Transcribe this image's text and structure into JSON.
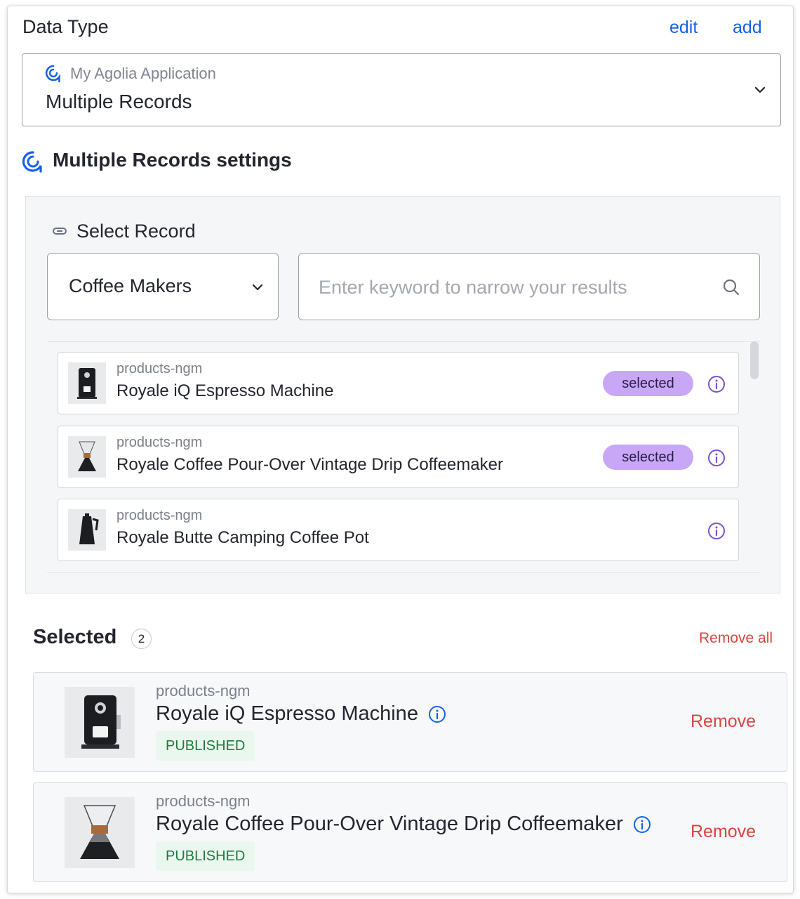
{
  "header": {
    "title": "Data Type",
    "edit_label": "edit",
    "add_label": "add"
  },
  "data_type_select": {
    "app_name": "My Agolia Application",
    "value": "Multiple Records"
  },
  "settings": {
    "title": "Multiple Records settings"
  },
  "record_picker": {
    "label": "Select Record",
    "category_value": "Coffee Makers",
    "search_placeholder": "Enter keyword to narrow your results",
    "results": [
      {
        "source": "products-ngm",
        "name": "Royale iQ Espresso Machine",
        "badge": "selected",
        "thumb": "espresso-machine-thumb"
      },
      {
        "source": "products-ngm",
        "name": "Royale Coffee Pour-Over Vintage Drip Coffeemaker",
        "badge": "selected",
        "thumb": "pour-over-thumb"
      },
      {
        "source": "products-ngm",
        "name": "Royale Butte Camping Coffee Pot",
        "badge": "",
        "thumb": "camping-pot-thumb"
      }
    ]
  },
  "selected": {
    "title": "Selected",
    "count": "2",
    "remove_all_label": "Remove all",
    "items": [
      {
        "source": "products-ngm",
        "name": "Royale iQ Espresso Machine",
        "status": "PUBLISHED",
        "remove_label": "Remove"
      },
      {
        "source": "products-ngm",
        "name": "Royale Coffee Pour-Over Vintage Drip Coffeemaker",
        "status": "PUBLISHED",
        "remove_label": "Remove"
      }
    ]
  },
  "colors": {
    "link": "#1660e8",
    "remove": "#d8453f",
    "badge_bg": "#c8a7f7",
    "info_icon": "#7b52c7",
    "published_text": "#1f7a3d"
  }
}
